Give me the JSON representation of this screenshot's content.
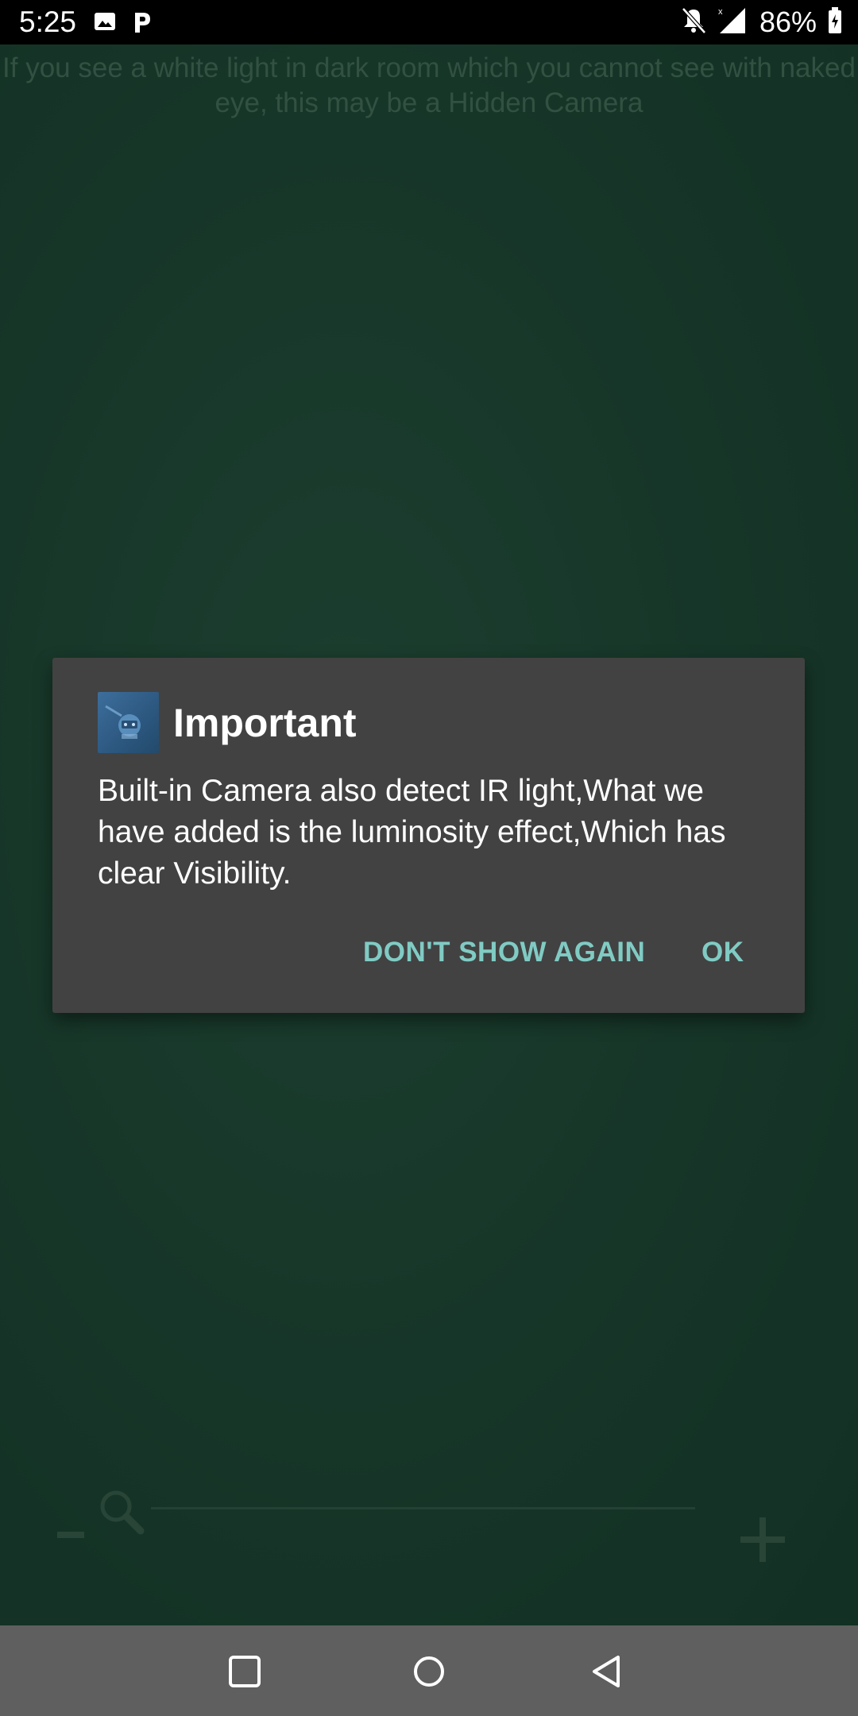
{
  "status_bar": {
    "time": "5:25",
    "battery_percent": "86%",
    "icons": [
      "image-icon",
      "p-icon",
      "notifications-off-icon",
      "cellular-signal-icon",
      "battery-icon"
    ]
  },
  "camera": {
    "hint_text": "If you see a white light in dark room which you cannot see with naked eye, this may be a Hidden Camera"
  },
  "dialog": {
    "title": "Important",
    "message": "Built-in Camera also detect IR light,What we have added is the luminosity effect,Which has clear Visibility.",
    "dont_show_label": "DON'T SHOW AGAIN",
    "ok_label": "OK",
    "accent_color": "#80cbc4"
  },
  "zoom": {
    "minus_icon": "minus-icon",
    "plus_icon": "plus-icon",
    "search_icon": "magnifier-icon"
  },
  "nav_bar": {
    "icons": [
      "recents-icon",
      "home-icon",
      "back-icon"
    ]
  }
}
